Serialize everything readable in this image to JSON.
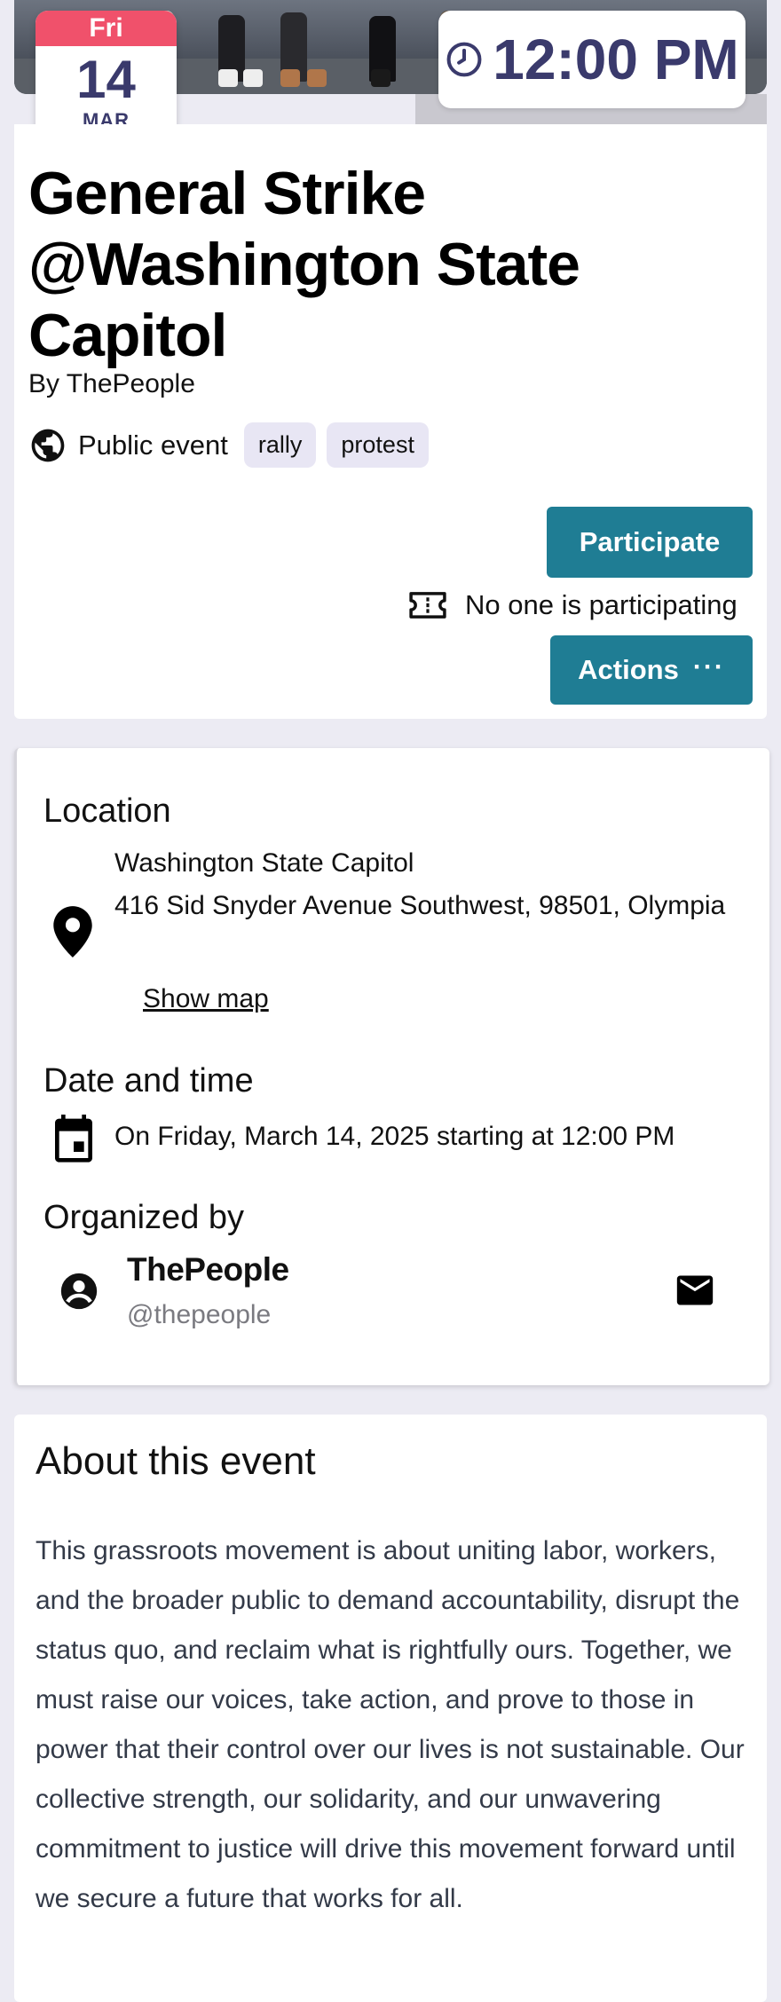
{
  "event": {
    "date": {
      "day_of_week": "Fri",
      "day": "14",
      "month": "MAR"
    },
    "time": "12:00 PM",
    "title": "General Strike @Washington State Capitol",
    "by_line": "By ThePeople",
    "visibility": "Public event",
    "tags": [
      "rally",
      "protest"
    ],
    "participate_label": "Participate",
    "participation_status": "No one is participating",
    "actions_label": "Actions",
    "actions_dots": "···"
  },
  "info": {
    "location_title": "Location",
    "location_name": "Washington State Capitol",
    "location_address": "416 Sid Snyder Avenue Southwest, 98501, Olympia",
    "show_map_label": "Show map",
    "datetime_title": "Date and time",
    "datetime_text": "On Friday, March 14, 2025 starting at 12:00 PM",
    "organizer_title": "Organized by",
    "organizer_name": "ThePeople",
    "organizer_handle": "@thepeople"
  },
  "about": {
    "title": "About this event",
    "text": "This grassroots movement is about uniting labor, workers, and the broader public to demand accountability, disrupt the status quo, and reclaim what is rightfully ours. Together, we must raise our voices, take action, and prove to those in power that their control over our lives is not sustainable. Our collective strength, our solidarity, and our unwavering commitment to justice will drive this movement forward until we secure a future that works for all."
  },
  "colors": {
    "accent_button": "#1f7d94",
    "badge_red": "#f0516b",
    "badge_text": "#3a3a6c",
    "tag_background": "#e8e6f4",
    "page_background": "#ecebf3"
  },
  "icons": [
    "clock-icon",
    "globe-icon",
    "ticket-icon",
    "map-pin-icon",
    "calendar-icon",
    "account-circle-icon",
    "email-icon"
  ]
}
